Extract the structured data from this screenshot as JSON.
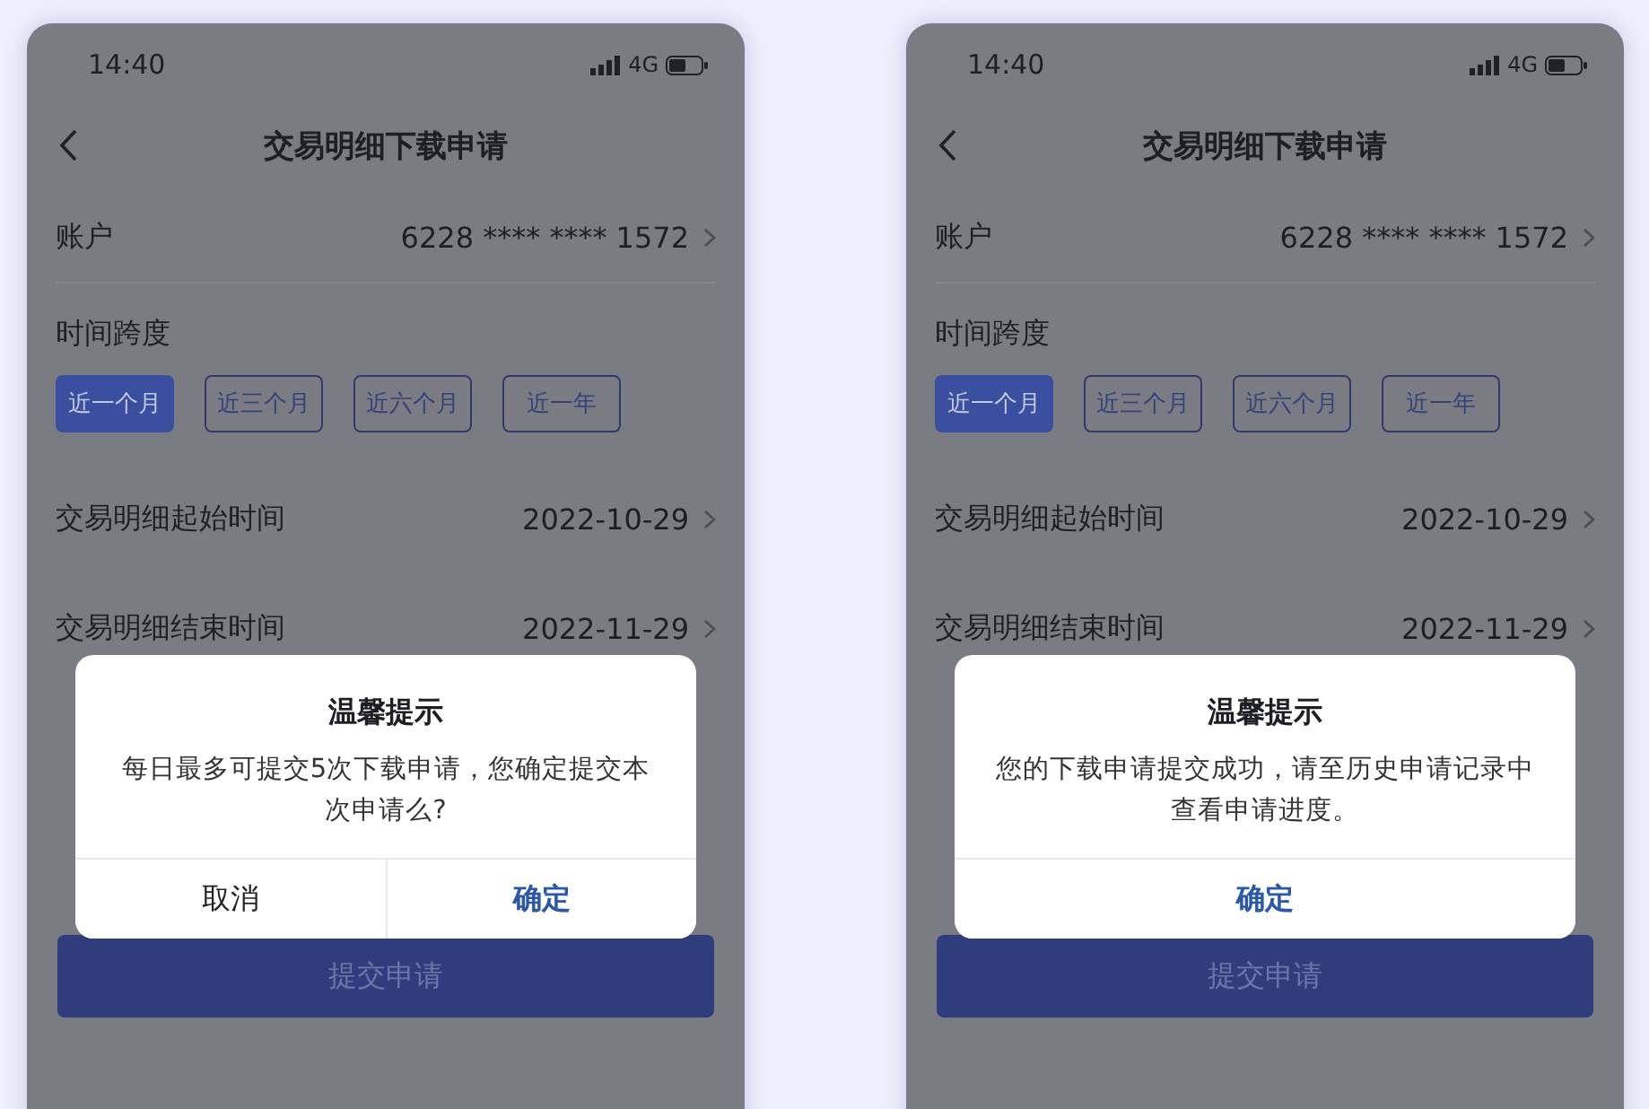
{
  "screens": [
    {
      "status": {
        "time": "14:40",
        "network": "4G"
      },
      "nav": {
        "title": "交易明细下载申请"
      },
      "account": {
        "label": "账户",
        "value": "6228 **** **** 1572"
      },
      "span": {
        "label": "时间跨度",
        "options": [
          {
            "label": "近一个月",
            "selected": true
          },
          {
            "label": "近三个月",
            "selected": false
          },
          {
            "label": "近六个月",
            "selected": false
          },
          {
            "label": "近一年",
            "selected": false
          }
        ]
      },
      "dates": [
        {
          "label": "交易明细起始时间",
          "value": "2022-10-29"
        },
        {
          "label": "交易明细结束时间",
          "value": "2022-11-29"
        }
      ],
      "submit": "提交申请",
      "dialog": {
        "title": "温馨提示",
        "message": "每日最多可提交5次下载申请，您确定提交本次申请么?",
        "buttons": [
          {
            "label": "取消",
            "kind": "cancel"
          },
          {
            "label": "确定",
            "kind": "confirm"
          }
        ]
      }
    },
    {
      "status": {
        "time": "14:40",
        "network": "4G"
      },
      "nav": {
        "title": "交易明细下载申请"
      },
      "account": {
        "label": "账户",
        "value": "6228 **** **** 1572"
      },
      "span": {
        "label": "时间跨度",
        "options": [
          {
            "label": "近一个月",
            "selected": true
          },
          {
            "label": "近三个月",
            "selected": false
          },
          {
            "label": "近六个月",
            "selected": false
          },
          {
            "label": "近一年",
            "selected": false
          }
        ]
      },
      "dates": [
        {
          "label": "交易明细起始时间",
          "value": "2022-10-29"
        },
        {
          "label": "交易明细结束时间",
          "value": "2022-11-29"
        }
      ],
      "submit": "提交申请",
      "dialog": {
        "title": "温馨提示",
        "message": "您的下载申请提交成功，请至历史申请记录中查看申请进度。",
        "buttons": [
          {
            "label": "确定",
            "kind": "confirm"
          }
        ]
      }
    }
  ]
}
